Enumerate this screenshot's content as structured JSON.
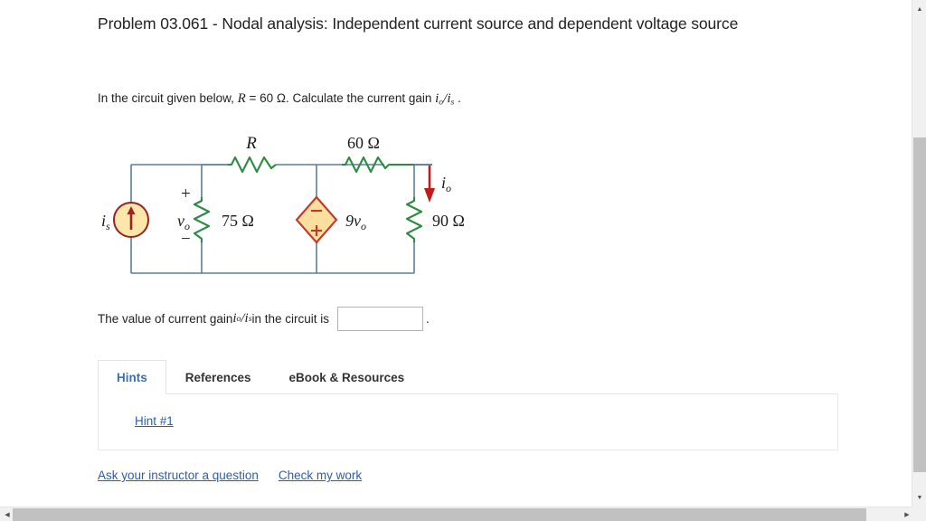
{
  "problem": {
    "title": "Problem 03.061 - Nodal analysis: Independent current source and dependent voltage source",
    "statement_part1": "In the circuit given below, ",
    "statement_R": "R",
    "statement_part2": " = 60 Ω. Calculate the current gain ",
    "statement_gain_num": "i",
    "statement_gain_num_sub": "o",
    "statement_slash": "/",
    "statement_gain_den": "i",
    "statement_gain_den_sub": "s",
    "statement_part3": " ."
  },
  "circuit": {
    "source_label": "i",
    "source_label_sub": "s",
    "node_voltage_label": "v",
    "node_voltage_sub": "o",
    "plus_sign": "+",
    "minus_sign": "−",
    "resistor_R_label": "R",
    "resistor_60_label": "60 Ω",
    "resistor_75_label": "75 Ω",
    "resistor_90_label": "90 Ω",
    "dependent_source_label": "9v",
    "dependent_source_sub": "o",
    "dependent_plus": "+",
    "dependent_minus": "−",
    "output_current_label": "i",
    "output_current_sub": "o",
    "colors": {
      "wire": "#5b7e9c",
      "resistor": "#2e8b45",
      "source_fill": "#fbe7a9",
      "source_stroke": "#9b2222",
      "arrow_red": "#c21b17",
      "dep_fill": "#fbdf9e",
      "dep_stroke": "#c0392b"
    }
  },
  "answer": {
    "text_before": "The value of current gain ",
    "gain_num": "i",
    "gain_num_sub": "o",
    "gain_slash": "/",
    "gain_den": "i",
    "gain_den_sub": "s",
    "text_after": " in the circuit is",
    "input_value": "",
    "input_placeholder": "",
    "period": "."
  },
  "tabs": [
    {
      "label": "Hints",
      "active": true
    },
    {
      "label": "References",
      "active": false
    },
    {
      "label": "eBook & Resources",
      "active": false
    }
  ],
  "hints": {
    "hint_link": "Hint #1"
  },
  "footer": {
    "ask_instructor": "Ask your instructor a question",
    "check_my_work": "Check my work"
  },
  "scrollbars": {
    "up_arrow": "▲",
    "down_arrow": "▼",
    "left_arrow": "◀",
    "right_arrow": "▶"
  },
  "theme": {
    "link_color": "#2b5faa",
    "active_tab_color": "#3b6fb6",
    "text_color": "#222222"
  }
}
